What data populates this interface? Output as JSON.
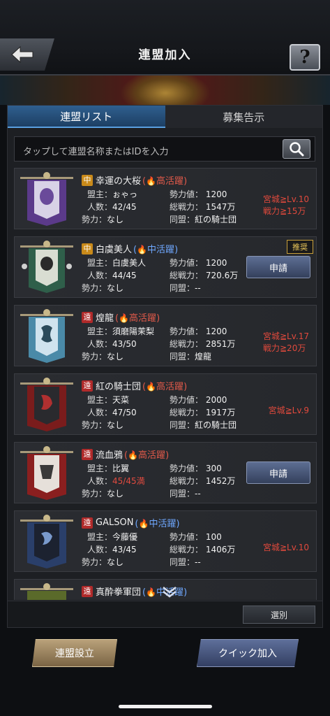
{
  "header": {
    "title": "連盟加入",
    "help_label": "?"
  },
  "tabs": [
    {
      "label": "連盟リスト",
      "active": true
    },
    {
      "label": "募集告示",
      "active": false
    }
  ],
  "search": {
    "placeholder": "タップして連盟名称またはIDを入力"
  },
  "labels": {
    "leader": "盟主：",
    "members": "人数：",
    "force": "勢力：",
    "power": "勢力値：",
    "total": "総戦力：",
    "ally": "同盟："
  },
  "alliances": [
    {
      "tag": "中",
      "name": "幸運の大桜",
      "activity": "高活躍",
      "leader": "ぉゃっ",
      "members": "42/45",
      "force": "なし",
      "power": "1200",
      "total": "1547万",
      "ally": "紅の騎士団",
      "req1": "宮城≧Lv.10",
      "req2": "戦力≧15万"
    },
    {
      "tag": "中",
      "name": "白虞美人",
      "activity": "中活躍",
      "leader": "白虞美人",
      "members": "44/45",
      "force": "なし",
      "power": "1200",
      "total": "720.6万",
      "ally": "--",
      "badge": "推奨",
      "button": "申請"
    },
    {
      "tag": "遠",
      "name": "煌龍",
      "activity": "高活躍",
      "leader": "須磨陽茉梨",
      "members": "43/50",
      "force": "なし",
      "power": "1200",
      "total": "2851万",
      "ally": "煌龍",
      "req1": "宮城≧Lv.17",
      "req2": "戦力≧20万"
    },
    {
      "tag": "遠",
      "name": "紅の騎士団",
      "activity": "高活躍",
      "leader": "天菜",
      "members": "47/50",
      "force": "なし",
      "power": "2000",
      "total": "1917万",
      "ally": "紅の騎士団",
      "req1": "宮城≧Lv.9"
    },
    {
      "tag": "遠",
      "name": "流血鴉",
      "activity": "高活躍",
      "leader": "比翼",
      "members": "45/45満",
      "force": "なし",
      "power": "300",
      "total": "1452万",
      "ally": "--",
      "button": "申請"
    },
    {
      "tag": "遠",
      "name": "GALSON",
      "activity": "中活躍",
      "leader": "今藤優",
      "members": "43/45",
      "force": "なし",
      "power": "100",
      "total": "1406万",
      "ally": "--",
      "req1": "宮城≧Lv.10"
    },
    {
      "tag": "遠",
      "name": "真酔拳軍団",
      "activity": "中活躍"
    }
  ],
  "select_label": "選別",
  "footer": {
    "settings_label": "連盟設立",
    "quick_join_label": "クイック加入"
  },
  "colors": {
    "high_activity": "#e25a4a",
    "mid_activity": "#6fa8ff",
    "requirement": "#e0493c"
  }
}
